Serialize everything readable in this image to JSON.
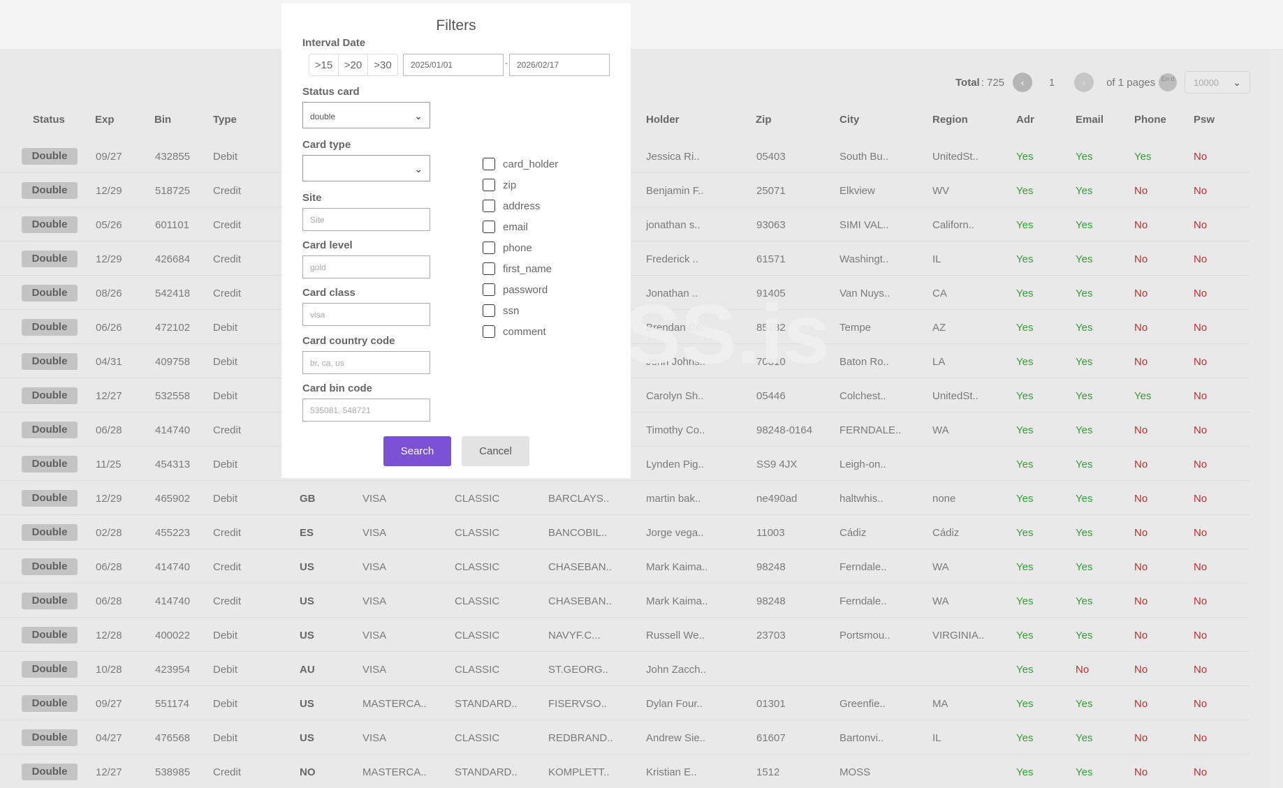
{
  "pager": {
    "total_label": "Total",
    "total_value": ": 725",
    "prev_icon": "‹",
    "page": "1",
    "next_icon": "›",
    "of_pages": "of 1 pages",
    "end_label": "En d",
    "per_page": "10000"
  },
  "columns": [
    "Status",
    "Exp",
    "Bin",
    "Type",
    "Holder",
    "Zip",
    "City",
    "Region",
    "Adr",
    "Email",
    "Phone",
    "Psw"
  ],
  "rows": [
    {
      "status": "Double",
      "exp": "09/27",
      "bin": "432855",
      "type": "Debit",
      "cc": "",
      "brand": "",
      "level": "",
      "bank": "",
      "holder": "Jessica Ri..",
      "zip": "05403",
      "city": "South Bu..",
      "region": "UnitedSt..",
      "adr": "Yes",
      "email": "Yes",
      "phone": "Yes",
      "psw": "No"
    },
    {
      "status": "Double",
      "exp": "12/29",
      "bin": "518725",
      "type": "Credit",
      "cc": "",
      "brand": "",
      "level": "",
      "bank": "",
      "holder": "Benjamin F..",
      "zip": "25071",
      "city": "Elkview",
      "region": "WV",
      "adr": "Yes",
      "email": "Yes",
      "phone": "No",
      "psw": "No"
    },
    {
      "status": "Double",
      "exp": "05/26",
      "bin": "601101",
      "type": "Credit",
      "cc": "",
      "brand": "",
      "level": "",
      "bank": "",
      "holder": "jonathan s..",
      "zip": "93063",
      "city": "SIMI VAL..",
      "region": "Californ..",
      "adr": "Yes",
      "email": "Yes",
      "phone": "No",
      "psw": "No"
    },
    {
      "status": "Double",
      "exp": "12/29",
      "bin": "426684",
      "type": "Credit",
      "cc": "",
      "brand": "",
      "level": "",
      "bank": "",
      "holder": "Frederick ..",
      "zip": "61571",
      "city": "Washingt..",
      "region": "IL",
      "adr": "Yes",
      "email": "Yes",
      "phone": "No",
      "psw": "No"
    },
    {
      "status": "Double",
      "exp": "08/26",
      "bin": "542418",
      "type": "Credit",
      "cc": "",
      "brand": "",
      "level": "",
      "bank": "",
      "holder": "Jonathan ..",
      "zip": "91405",
      "city": "Van Nuys..",
      "region": "CA",
      "adr": "Yes",
      "email": "Yes",
      "phone": "No",
      "psw": "No"
    },
    {
      "status": "Double",
      "exp": "06/26",
      "bin": "472102",
      "type": "Debit",
      "cc": "",
      "brand": "",
      "level": "",
      "bank": "",
      "holder": "Brendan Co..",
      "zip": "85282",
      "city": "Tempe",
      "region": "AZ",
      "adr": "Yes",
      "email": "Yes",
      "phone": "No",
      "psw": "No"
    },
    {
      "status": "Double",
      "exp": "04/31",
      "bin": "409758",
      "type": "Debit",
      "cc": "",
      "brand": "",
      "level": "",
      "bank": "",
      "holder": "John Johns..",
      "zip": "70810",
      "city": "Baton Ro..",
      "region": "LA",
      "adr": "Yes",
      "email": "Yes",
      "phone": "No",
      "psw": "No"
    },
    {
      "status": "Double",
      "exp": "12/27",
      "bin": "532558",
      "type": "Debit",
      "cc": "",
      "brand": "",
      "level": "",
      "bank": "",
      "holder": "Carolyn Sh..",
      "zip": "05446",
      "city": "Colchest..",
      "region": "UnitedSt..",
      "adr": "Yes",
      "email": "Yes",
      "phone": "Yes",
      "psw": "No"
    },
    {
      "status": "Double",
      "exp": "06/28",
      "bin": "414740",
      "type": "Credit",
      "cc": "",
      "brand": "",
      "level": "",
      "bank": "",
      "holder": "Timothy Co..",
      "zip": "98248-0164",
      "city": "FERNDALE..",
      "region": "WA",
      "adr": "Yes",
      "email": "Yes",
      "phone": "No",
      "psw": "No"
    },
    {
      "status": "Double",
      "exp": "11/25",
      "bin": "454313",
      "type": "Debit",
      "cc": "",
      "brand": "",
      "level": "",
      "bank": "",
      "holder": "Lynden Pig..",
      "zip": "SS9 4JX",
      "city": "Leigh-on..",
      "region": "",
      "adr": "Yes",
      "email": "Yes",
      "phone": "No",
      "psw": "No"
    },
    {
      "status": "Double",
      "exp": "12/29",
      "bin": "465902",
      "type": "Debit",
      "cc": "GB",
      "brand": "VISA",
      "level": "CLASSIC",
      "bank": "BARCLAYS..",
      "holder": "martin bak..",
      "zip": "ne490ad",
      "city": "haltwhis..",
      "region": "none",
      "adr": "Yes",
      "email": "Yes",
      "phone": "No",
      "psw": "No"
    },
    {
      "status": "Double",
      "exp": "02/28",
      "bin": "455223",
      "type": "Credit",
      "cc": "ES",
      "brand": "VISA",
      "level": "CLASSIC",
      "bank": "BANCOBIL..",
      "holder": "Jorge vega..",
      "zip": "11003",
      "city": "Cádiz",
      "region": "Cádiz",
      "adr": "Yes",
      "email": "Yes",
      "phone": "No",
      "psw": "No"
    },
    {
      "status": "Double",
      "exp": "06/28",
      "bin": "414740",
      "type": "Credit",
      "cc": "US",
      "brand": "VISA",
      "level": "CLASSIC",
      "bank": "CHASEBAN..",
      "holder": "Mark Kaima..",
      "zip": "98248",
      "city": "Ferndale..",
      "region": "WA",
      "adr": "Yes",
      "email": "Yes",
      "phone": "No",
      "psw": "No"
    },
    {
      "status": "Double",
      "exp": "06/28",
      "bin": "414740",
      "type": "Credit",
      "cc": "US",
      "brand": "VISA",
      "level": "CLASSIC",
      "bank": "CHASEBAN..",
      "holder": "Mark Kaima..",
      "zip": "98248",
      "city": "Ferndale..",
      "region": "WA",
      "adr": "Yes",
      "email": "Yes",
      "phone": "No",
      "psw": "No"
    },
    {
      "status": "Double",
      "exp": "12/28",
      "bin": "400022",
      "type": "Debit",
      "cc": "US",
      "brand": "VISA",
      "level": "CLASSIC",
      "bank": "NAVYF.C...",
      "holder": "Russell We..",
      "zip": "23703",
      "city": "Portsmou..",
      "region": "VIRGINIA..",
      "adr": "Yes",
      "email": "Yes",
      "phone": "No",
      "psw": "No"
    },
    {
      "status": "Double",
      "exp": "10/28",
      "bin": "423954",
      "type": "Debit",
      "cc": "AU",
      "brand": "VISA",
      "level": "CLASSIC",
      "bank": "ST.GEORG..",
      "holder": "John Zacch..",
      "zip": "",
      "city": "",
      "region": "",
      "adr": "Yes",
      "email": "No",
      "phone": "No",
      "psw": "No"
    },
    {
      "status": "Double",
      "exp": "09/27",
      "bin": "551174",
      "type": "Debit",
      "cc": "US",
      "brand": "MASTERCA..",
      "level": "STANDARD..",
      "bank": "FISERVSO..",
      "holder": "Dylan Four..",
      "zip": "01301",
      "city": "Greenfie..",
      "region": "MA",
      "adr": "Yes",
      "email": "Yes",
      "phone": "No",
      "psw": "No"
    },
    {
      "status": "Double",
      "exp": "04/27",
      "bin": "476568",
      "type": "Debit",
      "cc": "US",
      "brand": "VISA",
      "level": "CLASSIC",
      "bank": "REDBRAND..",
      "holder": "Andrew Sie..",
      "zip": "61607",
      "city": "Bartonvi..",
      "region": "IL",
      "adr": "Yes",
      "email": "Yes",
      "phone": "No",
      "psw": "No"
    },
    {
      "status": "Double",
      "exp": "12/27",
      "bin": "538985",
      "type": "Credit",
      "cc": "NO",
      "brand": "MASTERCA..",
      "level": "STANDARD..",
      "bank": "KOMPLETT..",
      "holder": "Kristian E..",
      "zip": "1512",
      "city": "MOSS",
      "region": "",
      "adr": "Yes",
      "email": "Yes",
      "phone": "No",
      "psw": "No"
    }
  ],
  "watermark": {
    "text": "SS.is",
    "mark": "~/"
  },
  "filters": {
    "title": "Filters",
    "interval_label": "Interval Date",
    "presets": [
      ">15",
      ">20",
      ">30"
    ],
    "date_from": "2025/01/01",
    "date_sep": "-",
    "date_to": "2026/02/17",
    "status_label": "Status card",
    "status_value": "double",
    "card_type_label": "Card type",
    "card_type_value": "",
    "site_label": "Site",
    "site_placeholder": "Site",
    "level_label": "Card level",
    "level_placeholder": "gold",
    "class_label": "Card class",
    "class_placeholder": "visa",
    "country_label": "Card country code",
    "country_placeholder": "br, ca, us",
    "bin_label": "Card bin code",
    "bin_placeholder": "535081, 548721",
    "checkboxes": [
      "card_holder",
      "zip",
      "address",
      "email",
      "phone",
      "first_name",
      "password",
      "ssn",
      "comment"
    ],
    "search_label": "Search",
    "cancel_label": "Cancel"
  }
}
